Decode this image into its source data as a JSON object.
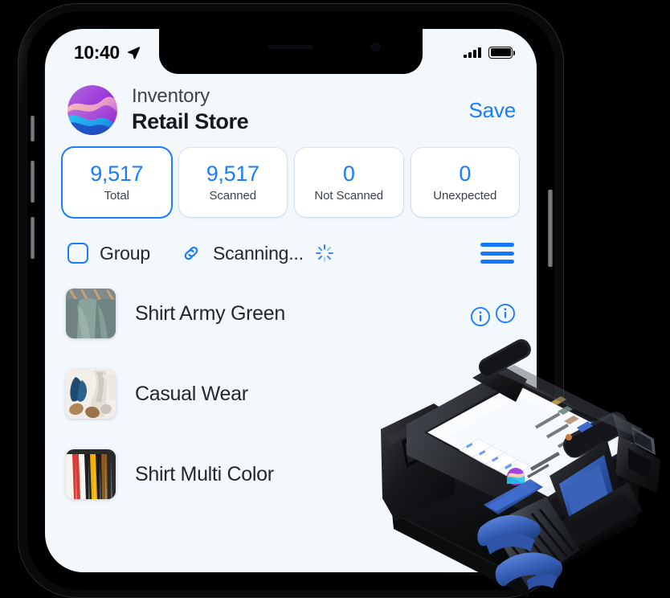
{
  "meta": {
    "scene": "iPhone mockup showing an RFID inventory counting app, with a handheld RFID sled scanner photo overlapping the lower-right corner",
    "background_color": "#000000"
  },
  "colors": {
    "accent_blue": "#1a7cff",
    "screen_background": "#f3f8fd",
    "card_background": "#ffffff",
    "text_primary": "#24282d",
    "text_secondary": "#3d4349",
    "device_black": "#1a1a1d",
    "device_blue": "#2f5fd0"
  },
  "status_bar": {
    "time": "10:40",
    "location_icon": "location-arrow-icon",
    "signal_icon": "cellular-signal-icon",
    "signal_bars": 4,
    "battery_icon": "battery-full-icon",
    "battery_level": 100
  },
  "header": {
    "logo_icon": "app-logo-icon",
    "subtitle": "Inventory",
    "title": "Retail Store",
    "save_label": "Save"
  },
  "stats": [
    {
      "value": "9,517",
      "label": "Total",
      "selected": true
    },
    {
      "value": "9,517",
      "label": "Scanned",
      "selected": false
    },
    {
      "value": "0",
      "label": "Not Scanned",
      "selected": false
    },
    {
      "value": "0",
      "label": "Unexpected",
      "selected": false
    }
  ],
  "toolbar": {
    "group_checkbox_icon": "checkbox-unchecked-icon",
    "group_label": "Group",
    "group_checked": false,
    "link_icon": "link-chain-icon",
    "status_label": "Scanning...",
    "spinner_icon": "loading-spinner-icon",
    "menu_icon": "hamburger-menu-icon"
  },
  "list": {
    "items": [
      {
        "name": "Shirt Army Green",
        "thumb_icon": "product-thumbnail-green-shirts",
        "info_icon": "info-circle-icon",
        "has_info": true
      },
      {
        "name": "Casual Wear",
        "thumb_icon": "product-thumbnail-casual-wear",
        "info_icon": "info-circle-icon",
        "has_info": false
      },
      {
        "name": "Shirt Multi Color",
        "thumb_icon": "product-thumbnail-color-shirts",
        "info_icon": "info-circle-icon",
        "has_info": false
      }
    ]
  },
  "scanner_device": {
    "name": "rfid-handheld-scanner",
    "description": "Black RFID sled with blue trigger and blue strap holding a smartphone running the same inventory app"
  }
}
